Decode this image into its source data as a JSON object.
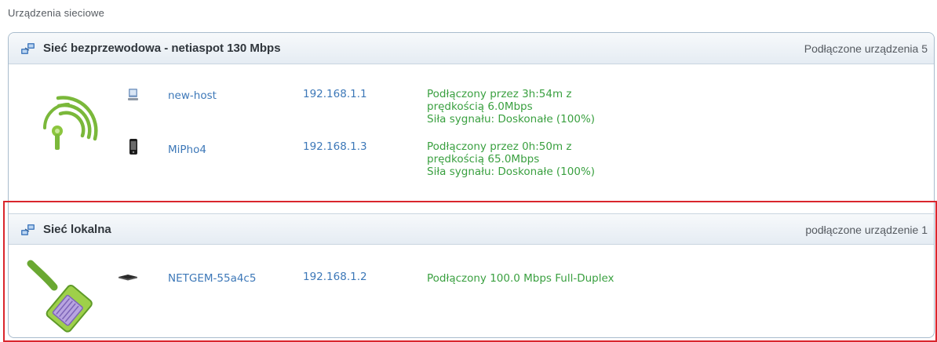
{
  "page_title": "Urządzenia sieciowe",
  "wireless": {
    "icon": "network-icon",
    "title": "Sieć bezprzewodowa - netiaspot 130 Mbps",
    "count_label": "Podłączone urządzenia 5",
    "section_icon": "wifi-signal-icon",
    "devices": [
      {
        "icon": "computer-icon",
        "name": "new-host",
        "ip": "192.168.1.1",
        "status_lines": [
          "Podłączony przez 3h:54m z",
          "prędkością 6.0Mbps",
          "Siła sygnału: Doskonałe (100%)"
        ]
      },
      {
        "icon": "phone-icon",
        "name": "MiPho4",
        "ip": "192.168.1.3",
        "status_lines": [
          "Podłączony przez 0h:50m z",
          "prędkością 65.0Mbps",
          "Siła sygnału: Doskonałe (100%)"
        ]
      }
    ]
  },
  "local": {
    "icon": "network-icon",
    "title": "Sieć lokalna",
    "count_label": "podłączone urządzenie 1",
    "section_icon": "ethernet-cable-icon",
    "devices": [
      {
        "icon": "set-top-box-icon",
        "name": "NETGEM-55a4c5",
        "ip": "192.168.1.2",
        "status_lines": [
          "Podłączony 100.0 Mbps Full-Duplex"
        ]
      }
    ]
  },
  "colors": {
    "link": "#3d78b8",
    "status": "#3aa040",
    "highlight": "#d9262d",
    "panel_border": "#a9bccd"
  }
}
